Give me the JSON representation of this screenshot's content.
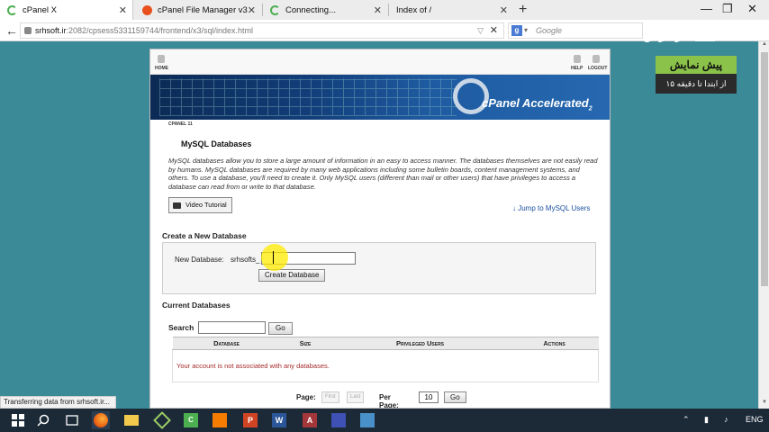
{
  "browser": {
    "tabs": [
      {
        "title": "cPanel X",
        "active": true
      },
      {
        "title": "cPanel File Manager v3",
        "active": false
      },
      {
        "title": "Connecting...",
        "active": false
      },
      {
        "title": "Index of /",
        "active": false
      }
    ],
    "url_host": "srhsoft.ir",
    "url_rest": ":2082/cpsess5331159744/frontend/x3/sql/index.html",
    "search_placeholder": "Google",
    "status_text": "Transferring data from srhsoft.ir..."
  },
  "overlay": {
    "logo_text": "گرادرس",
    "promo_line1": "پیش نمایش",
    "promo_line2": "از ابتدا تا دقیقه ۱۵"
  },
  "cpanel": {
    "nav": {
      "home": "HOME",
      "help": "HELP",
      "logout": "LOGOUT"
    },
    "brand": "cPanel Accelerated",
    "brand_sub": "2",
    "version": "CPANEL 11",
    "page_title": "MySQL Databases",
    "description": "MySQL databases allow you to store a large amount of information in an easy to access manner. The databases themselves are not easily read by humans. MySQL databases are required by many web applications including some bulletin boards, content management systems, and others. To use a database, you'll need to create it. Only MySQL users (different than mail or other users) that have privileges to access a database can read from or write to that database.",
    "video_tutorial_label": "Video Tutorial",
    "jump_link": "↓ Jump to MySQL Users",
    "create": {
      "heading": "Create a New Database",
      "label": "New Database:",
      "prefix": "srhsofts_",
      "value": "",
      "button": "Create Database"
    },
    "current": {
      "heading": "Current Databases",
      "search_label": "Search",
      "go_label": "Go",
      "columns": [
        "Database",
        "Size",
        "Privileged Users",
        "Actions"
      ],
      "empty_message": "Your account is not associated with any databases."
    },
    "pager": {
      "page_label": "Page:",
      "first": "First",
      "last": "Last",
      "per_page_label": "Per Page:",
      "per_page_value": "10",
      "go_label": "Go"
    }
  },
  "taskbar": {
    "language": "ENG"
  }
}
